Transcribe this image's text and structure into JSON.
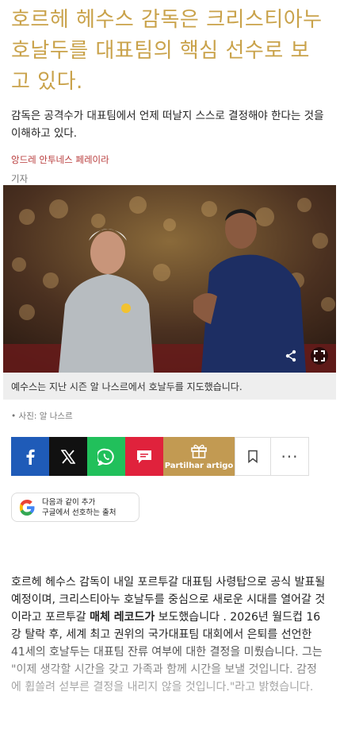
{
  "article": {
    "headline": "호르헤 헤수스 감독은 크리스티아누 호날두를 대표팀의 핵심 선수로 보고 있다.",
    "subtitle": "감독은 공격수가 대표팀에서 언제 떠날지 스스로 결정해야 한다는 것을 이해하고 있다.",
    "author": "앙드레 안투네스 페레이라",
    "author_role": "기자"
  },
  "photo": {
    "caption": "예수스는 지난 시즌 알 나스르에서 호날두를 지도했습니다.",
    "credit": "• 사진: 알 나스르",
    "share_icon": "share-icon",
    "fullscreen_icon": "fullscreen-icon"
  },
  "share_bar": {
    "partilhar_label": "Partilhar artigo",
    "facebook_icon": "facebook-icon",
    "x_icon": "x-icon",
    "whatsapp_icon": "whatsapp-icon",
    "sms_icon": "sms-icon",
    "gift_icon": "gift-icon",
    "bookmark_icon": "bookmark-icon",
    "more_label": "···"
  },
  "google_pref": {
    "line1": "다음과 같이 추가",
    "line2": "구글에서 선호하는 출처"
  },
  "body": {
    "p1_a": "호르헤 헤수스 감독이 내일 포르투갈 대표팀 사령탑으로 공식 발표될 예정이며, 크리스티아누 호날두를 중심으로 새로운 시대를 열어갈 것이라고 포르투갈 ",
    "p1_bold": "매체 레코드가",
    "p1_b": " 보도했습니다 . 2026년 월드컵 16강 탈락 후, 세계 최고 권위의 국가대표팀 대회에서 은퇴를 선언한 41세의 호날두는 대표팀 잔류 여부에 대한 결정을 미뤘습니다. 그는 \"이제 생각할 시간을 갖고 가족과 함께 시간을 보낼 것입니다. 감정에 휩쓸려 섣부른 결정을 내리지 않을 것입니다.\"라고 밝혔습니다."
  },
  "colors": {
    "headline": "#c9a24a",
    "author": "#b83b3b",
    "facebook": "#1f5bb8",
    "x": "#111111",
    "whatsapp": "#21c05b",
    "sms": "#e0223c",
    "partilhar": "#c29a52"
  }
}
